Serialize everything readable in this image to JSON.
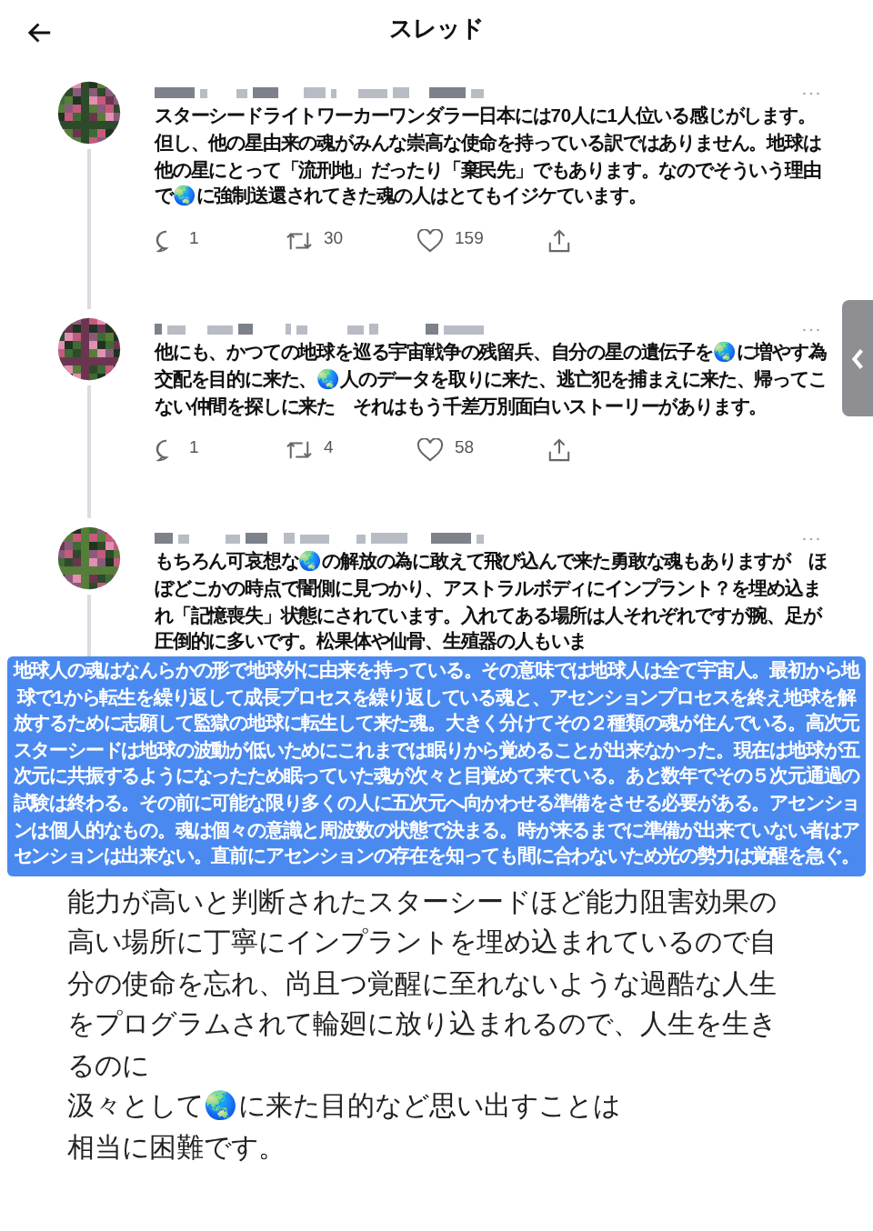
{
  "header": {
    "title": "スレッド"
  },
  "tweets": [
    {
      "text": "スターシードライトワーカーワンダラー日本には70人に1人位いる感じがします。但し、他の星由来の魂がみんな崇高な使命を持っている訳ではありません。地球は他の星にとって「流刑地」だったり「棄民先」でもあります。なのでそういう理由で🌏に強制送還されてきた魂の人はとてもイジケています。",
      "replies": "1",
      "retweets": "30",
      "likes": "159"
    },
    {
      "text": "他にも、かつての地球を巡る宇宙戦争の残留兵、自分の星の遺伝子を🌏に増やす為交配を目的に来た、🌏人のデータを取りに来た、逃亡犯を捕まえに来た、帰ってこない仲間を探しに来た　それはもう千差万別面白いストーリーがあります。",
      "replies": "1",
      "retweets": "4",
      "likes": "58"
    },
    {
      "text": "もちろん可哀想な🌏の解放の為に敢えて飛び込んで来た勇敢な魂もありますが　ほぼどこかの時点で闇側に見つかり、アストラルボディにインプラント？を埋め込まれ「記憶喪失」状態にされています。入れてある場所は人それぞれですが腕、足が圧倒的に多いです。松果体や仙骨、生殖器の人もいま"
    }
  ],
  "overlay": {
    "text": "地球人の魂はなんらかの形で地球外に由来を持っている。その意味では地球人は全て宇宙人。最初から地球で1から転生を繰り返して成長プロセスを繰り返している魂と、アセンションプロセスを終え地球を解放するために志願して監獄の地球に転生して来た魂。大きく分けてその２種類の魂が住んでいる。高次元スターシードは地球の波動が低いためにこれまでは眠りから覚めることが出来なかった。現在は地球が五次元に共振するようになったため眠っていた魂が次々と目覚めて来ている。あと数年でその５次元通過の試験は終わる。その前に可能な限り多くの人に五次元へ向かわせる準備をさせる必要がある。アセンションは個人的なもの。魂は個々の意識と周波数の状態で決まる。時が来るまでに準備が出来ていない者はアセンションは出来ない。直前にアセンションの存在を知っても間に合わないため光の勢力は覚醒を急ぐ。"
  },
  "continuation": {
    "lines": [
      "能力が高いと判断されたスターシードほど能力阻害効果の高い場所に丁寧にインプラントを埋め込まれているので自分の使命を忘れ、尚且つ覚醒に至れないような過酷な人生をプログラムされて輪廻に放り込まれるので、人生を生きるのに",
      "汲々として🌏に来た目的など思い出すことは",
      "相当に困難です。"
    ]
  }
}
